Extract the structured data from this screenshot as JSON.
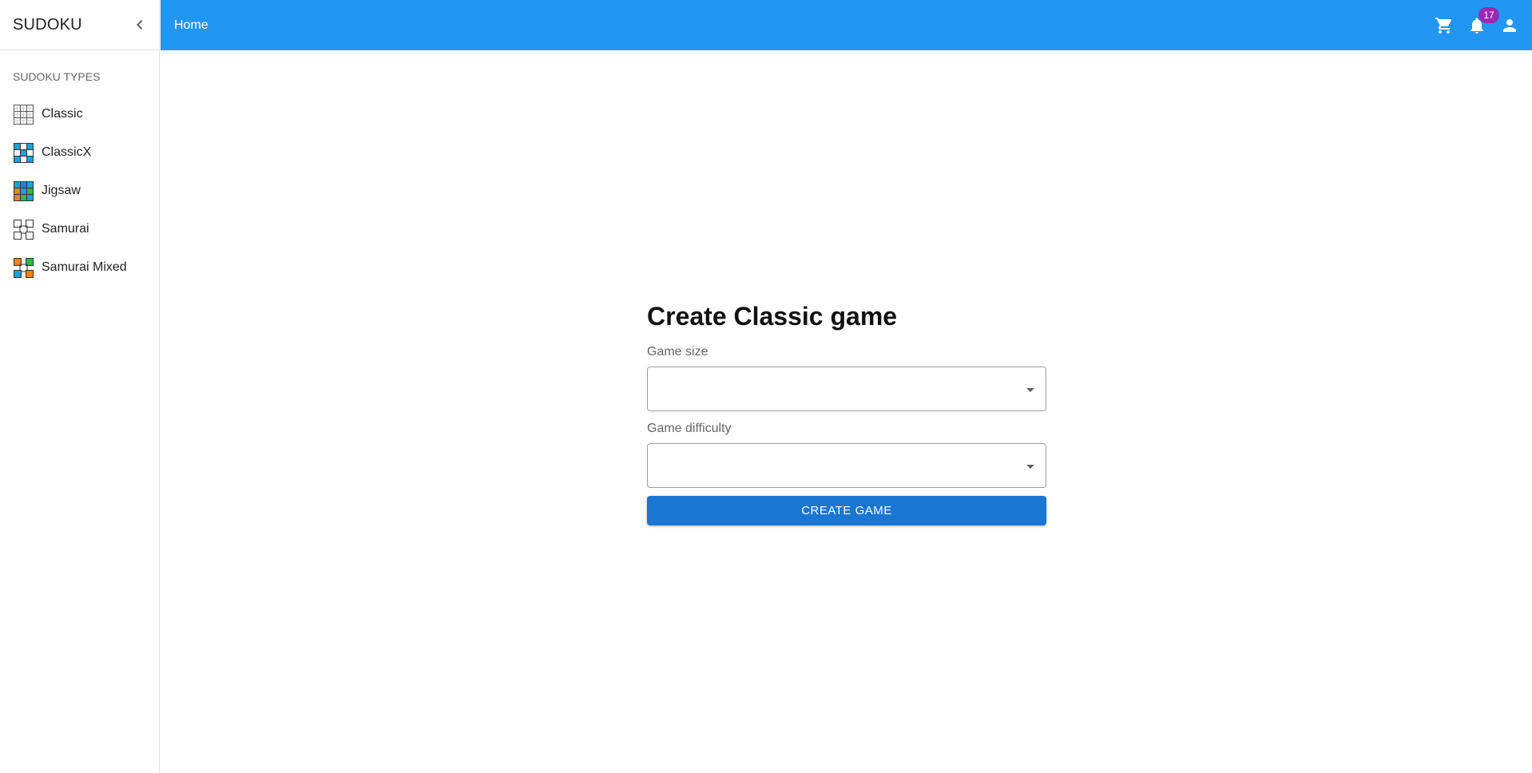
{
  "sidebar": {
    "brand": "SUDOKU",
    "section_title": "SUDOKU TYPES",
    "items": [
      {
        "label": "Classic",
        "icon": "classic-grid-icon"
      },
      {
        "label": "ClassicX",
        "icon": "classicx-grid-icon"
      },
      {
        "label": "Jigsaw",
        "icon": "jigsaw-grid-icon"
      },
      {
        "label": "Samurai",
        "icon": "samurai-grid-icon"
      },
      {
        "label": "Samurai Mixed",
        "icon": "samurai-mixed-grid-icon"
      }
    ]
  },
  "topbar": {
    "breadcrumb": "Home",
    "notification_count": "17",
    "icons": [
      "cart-icon",
      "bell-icon",
      "account-icon"
    ]
  },
  "form": {
    "title": "Create Classic game",
    "game_size_label": "Game size",
    "game_size_value": "",
    "game_difficulty_label": "Game difficulty",
    "game_difficulty_value": "",
    "create_button": "CREATE GAME"
  },
  "colors": {
    "appbar": "#2196f3",
    "primary_button": "#1976d2",
    "badge": "#9c27b0",
    "icon_blue": "#1ea0d8",
    "icon_orange": "#e8821e",
    "icon_green": "#2db84a"
  }
}
